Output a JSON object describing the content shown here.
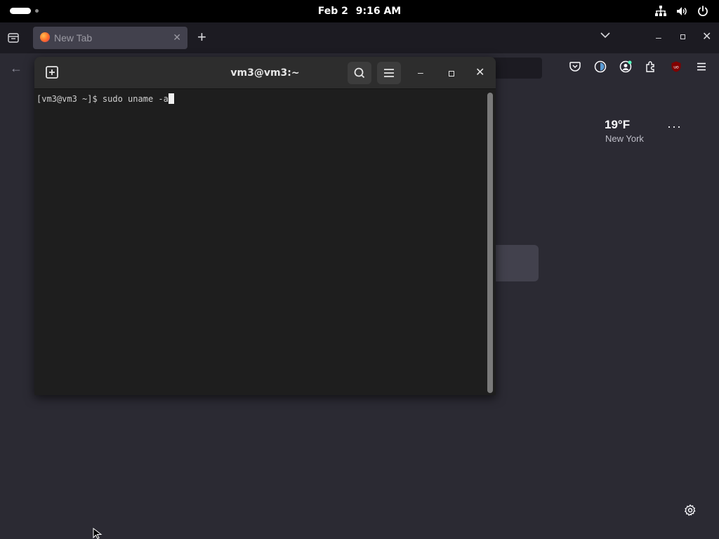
{
  "top_bar": {
    "date": "Feb 2",
    "time": "9:16 AM",
    "tray_icons": [
      "network-icon",
      "volume-icon",
      "power-icon"
    ]
  },
  "firefox": {
    "tab": {
      "title": "New Tab"
    },
    "toolbar_icons": [
      "pocket-icon",
      "sync-icon",
      "account-icon",
      "extensions-icon",
      "ublock-icon",
      "menu-icon"
    ],
    "new_tab_page": {
      "weather": {
        "temperature": "19°F",
        "city": "New York",
        "menu": "···"
      }
    }
  },
  "terminal": {
    "title": "vm3@vm3:~",
    "prompt": "[vm3@vm3 ~]$ ",
    "command": "sudo uname -a"
  }
}
